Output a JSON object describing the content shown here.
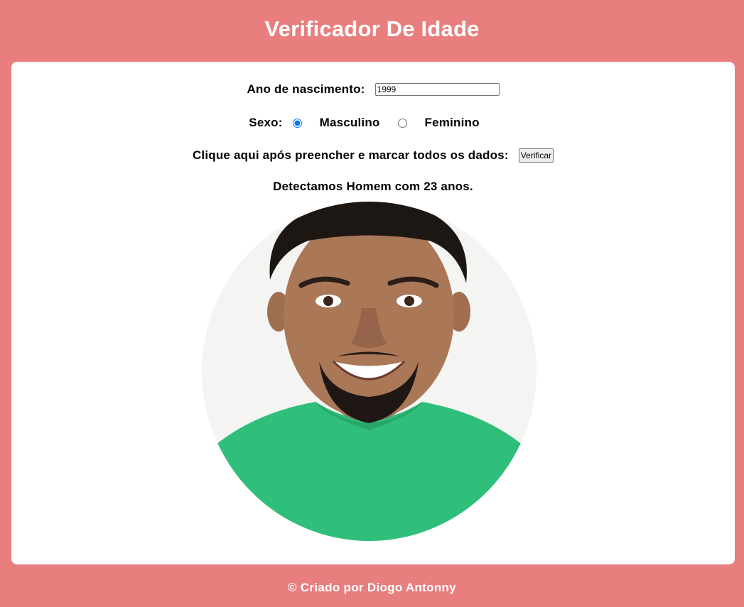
{
  "header": {
    "title": "Verificador De Idade"
  },
  "form": {
    "ano_label": "Ano de nascimento:",
    "ano_value": "1999",
    "sexo_label": "Sexo:",
    "options": [
      {
        "label": "Masculino",
        "checked": true
      },
      {
        "label": "Feminino",
        "checked": false
      }
    ],
    "verificar_text": "Clique aqui após preencher e marcar todos os dados:",
    "verificar_button": "Verificar"
  },
  "result": {
    "text": "Detectamos Homem com 23 anos."
  },
  "footer": {
    "text": "© Criado por Diogo Antonny"
  },
  "colors": {
    "background": "#e97e7e",
    "panel": "#ffffff",
    "shirt": "#2fbf7a"
  },
  "icons": {
    "photo": "portrait-photo"
  }
}
